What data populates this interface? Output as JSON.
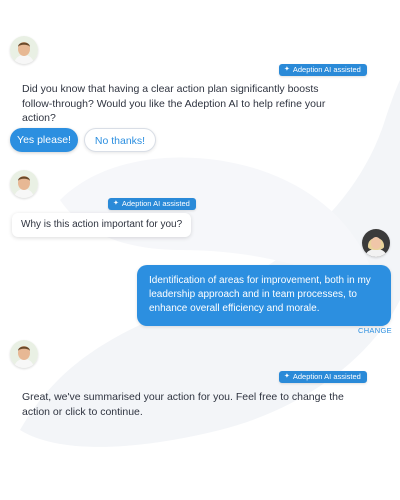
{
  "colors": {
    "accent": "#2c8fe0",
    "badge": "#2a8ad8",
    "text": "#2f3440"
  },
  "ai_badge": {
    "label": "Adeption AI assisted",
    "icon": "sparkle-icon"
  },
  "messages": [
    {
      "sender": "bot",
      "text": "Did you know that having a clear action plan significantly boosts follow-through? Would you like the Adeption AI to help refine your action?",
      "options": [
        "Yes please!",
        "No thanks!"
      ]
    },
    {
      "sender": "bot",
      "text": "Why is this action important for you?"
    },
    {
      "sender": "user",
      "text": "Identification of areas for improvement, both in my leadership approach and in team processes, to enhance overall efficiency and morale.",
      "action": "CHANGE"
    },
    {
      "sender": "bot",
      "text": "Great, we've summarised your action for you. Feel free to change the action or click to continue."
    }
  ]
}
